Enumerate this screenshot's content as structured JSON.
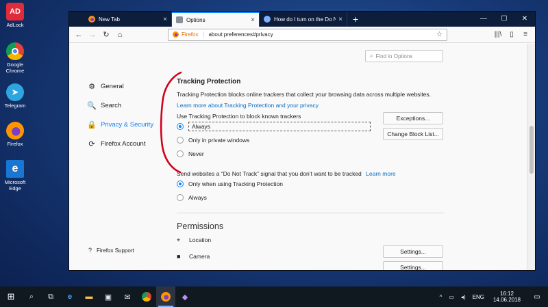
{
  "desktop": {
    "icons": [
      {
        "label": "AdLock",
        "glyph": "AD"
      },
      {
        "label": "Google Chrome"
      },
      {
        "label": "Telegram",
        "glyph": "➤"
      },
      {
        "label": "Firefox"
      },
      {
        "label": "Microsoft Edge",
        "glyph": "e"
      }
    ]
  },
  "browser": {
    "tabs": [
      {
        "title": "New Tab",
        "close": "×"
      },
      {
        "title": "Options",
        "close": "×"
      },
      {
        "title": "How do I turn on the Do Not T",
        "close": "×"
      }
    ],
    "newtab": "+",
    "win": {
      "minimize": "—",
      "maximize": "☐",
      "close": "✕"
    },
    "nav": {
      "back": "←",
      "forward": "→",
      "reload": "↻",
      "home": "⌂"
    },
    "urlbar": {
      "identity": "Firefox",
      "url": "about:preferences#privacy",
      "star": "☆"
    },
    "toolbar_right": {
      "library": "|||\\",
      "sidebar": "▯",
      "menu": "≡"
    }
  },
  "prefs": {
    "find_placeholder": "Find in Options",
    "sidebar": [
      {
        "label": "General",
        "icon": "⚙"
      },
      {
        "label": "Search",
        "icon": "🔍"
      },
      {
        "label": "Privacy & Security",
        "icon": "🔒"
      },
      {
        "label": "Firefox Account",
        "icon": "⟳"
      }
    ],
    "support": {
      "label": "Firefox Support",
      "icon": "?"
    },
    "tracking": {
      "heading": "Tracking Protection",
      "description": "Tracking Protection blocks online trackers that collect your browsing data across multiple websites.",
      "learn_more": "Learn more about Tracking Protection and your privacy",
      "use_label": "Use Tracking Protection to block known trackers",
      "options": [
        "Always",
        "Only in private windows",
        "Never"
      ],
      "selected": 0,
      "exceptions_btn": "Exceptions...",
      "blocklist_btn": "Change Block List..."
    },
    "dnt": {
      "text": "Send websites a “Do Not Track” signal that you don’t want to be tracked",
      "learn_more": "Learn more",
      "options": [
        "Only when using Tracking Protection",
        "Always"
      ],
      "selected": 0
    },
    "permissions": {
      "heading": "Permissions",
      "rows": [
        {
          "label": "Location",
          "button": "Settings..."
        },
        {
          "label": "Camera",
          "button": "Settings..."
        }
      ]
    }
  },
  "taskbar": {
    "start": "⊞",
    "search": "⌕",
    "taskview": "⧉",
    "clock_time": "16:12",
    "clock_date": "14.06.2018",
    "lang": "ENG",
    "tray_chevron": "^",
    "notifications": "▭"
  },
  "colors": {
    "accent": "#0a84ff",
    "annotation": "#d0021b",
    "tabbar": "#0c1e3c"
  }
}
